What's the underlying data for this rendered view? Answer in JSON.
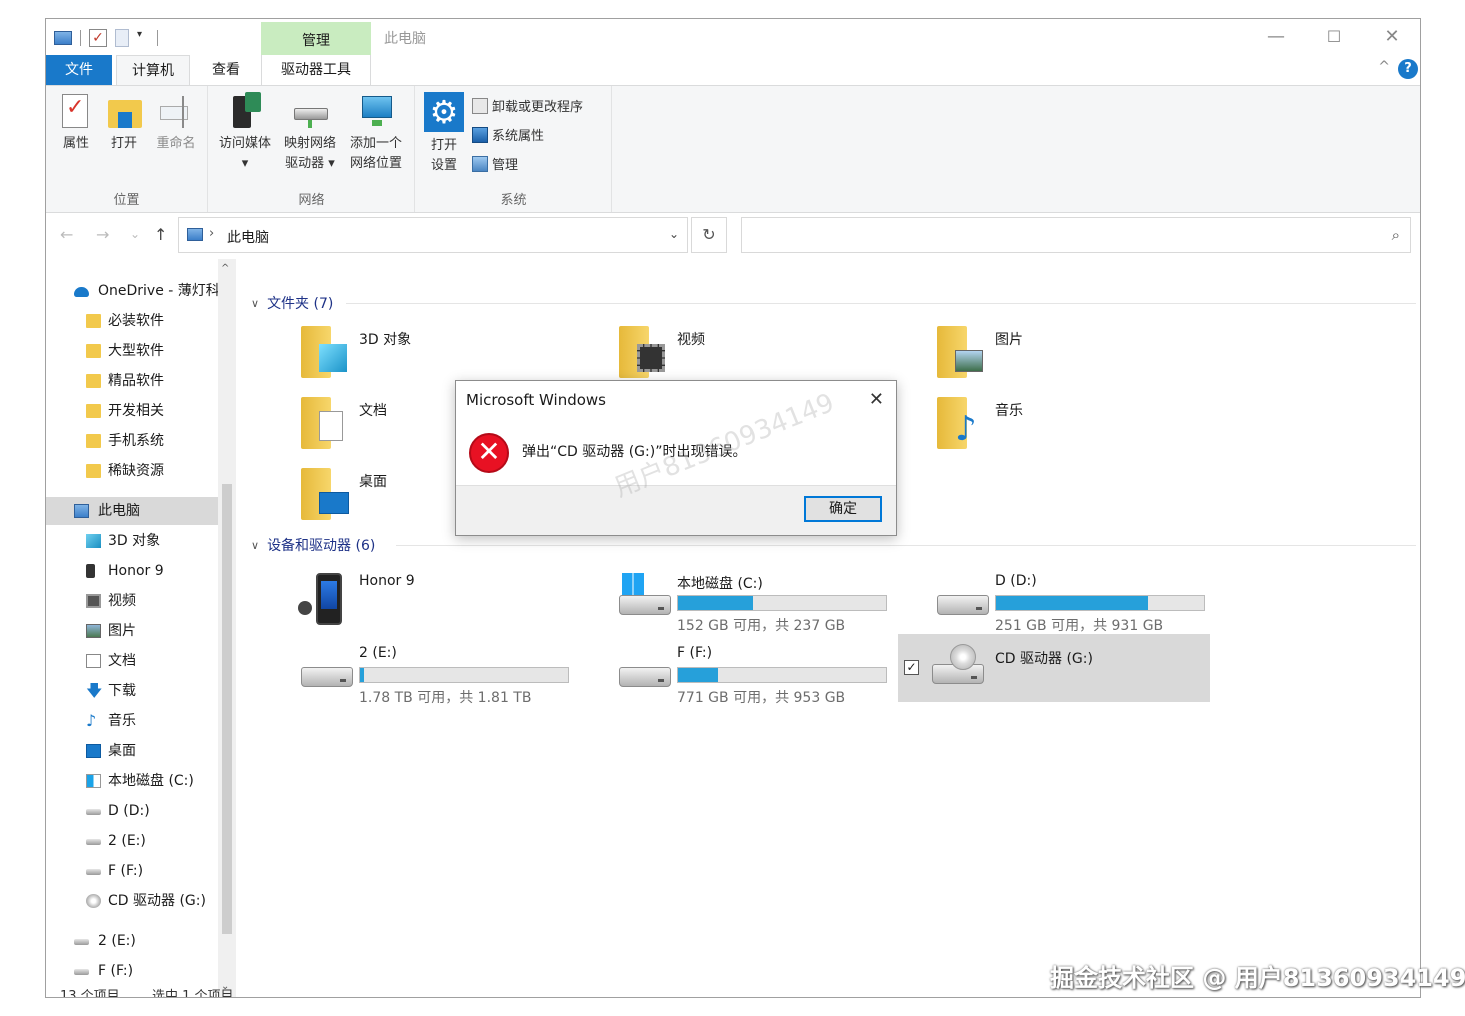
{
  "window": {
    "title": "此电脑",
    "min": "—",
    "max": "☐",
    "close": "✕"
  },
  "quick_access": {
    "dropdown": "▾"
  },
  "tabs": {
    "file": "文件",
    "computer": "计算机",
    "view": "查看",
    "manage": "管理",
    "drive_tools": "驱动器工具"
  },
  "help": {
    "collapse": "^",
    "icon": "?"
  },
  "ribbon": {
    "groups": {
      "location": "位置",
      "network": "网络",
      "system": "系统"
    },
    "properties": "属性",
    "open": "打开",
    "rename": "重命名",
    "access_media": "访问媒体",
    "access_media_arrow": "▾",
    "map_drive_1": "映射网络",
    "map_drive_2": "驱动器 ▾",
    "add_location_1": "添加一个",
    "add_location_2": "网络位置",
    "open_settings_1": "打开",
    "open_settings_2": "设置",
    "uninstall": "卸载或更改程序",
    "system_props": "系统属性",
    "manage": "管理"
  },
  "address": {
    "back": "←",
    "forward": "→",
    "recent": "⌄",
    "up": "↑",
    "chevron": "›",
    "path": "此电脑",
    "dropdown": "⌄",
    "refresh": "↻",
    "search_placeholder": "",
    "search_icon": "⌕"
  },
  "nav": {
    "scroll_up": "^",
    "scroll_down": "⌄",
    "items": [
      {
        "label": "OneDrive - 薄灯科",
        "icon": "cloud"
      },
      {
        "label": "必装软件",
        "icon": "folder"
      },
      {
        "label": "大型软件",
        "icon": "folder"
      },
      {
        "label": "精品软件",
        "icon": "folder"
      },
      {
        "label": "开发相关",
        "icon": "folder"
      },
      {
        "label": "手机系统",
        "icon": "folder"
      },
      {
        "label": "稀缺资源",
        "icon": "folder"
      },
      {
        "label": "此电脑",
        "icon": "pc"
      },
      {
        "label": "3D 对象",
        "icon": "3d"
      },
      {
        "label": "Honor 9",
        "icon": "phone"
      },
      {
        "label": "视频",
        "icon": "video"
      },
      {
        "label": "图片",
        "icon": "picture"
      },
      {
        "label": "文档",
        "icon": "document"
      },
      {
        "label": "下载",
        "icon": "download"
      },
      {
        "label": "音乐",
        "icon": "music"
      },
      {
        "label": "桌面",
        "icon": "desktop"
      },
      {
        "label": "本地磁盘 (C:)",
        "icon": "windows-drive"
      },
      {
        "label": "D (D:)",
        "icon": "drive"
      },
      {
        "label": "2 (E:)",
        "icon": "drive"
      },
      {
        "label": "F (F:)",
        "icon": "drive"
      },
      {
        "label": "CD 驱动器 (G:)",
        "icon": "cd"
      },
      {
        "label": "2 (E:)",
        "icon": "drive"
      },
      {
        "label": "F (F:)",
        "icon": "drive"
      }
    ]
  },
  "status": {
    "count": "13 个项目",
    "selected": "选中 1 个项目"
  },
  "content": {
    "folders_header": "文件夹 (7)",
    "devices_header": "设备和驱动器 (6)",
    "folders": [
      {
        "name": "3D 对象"
      },
      {
        "name": "视频"
      },
      {
        "name": "图片"
      },
      {
        "name": "文档"
      },
      {
        "name": "音乐"
      },
      {
        "name": "桌面"
      }
    ],
    "drives": [
      {
        "name": "Honor 9"
      },
      {
        "name": "本地磁盘 (C:)",
        "free": "152 GB 可用，共 237 GB",
        "used_fraction": 0.36
      },
      {
        "name": "D (D:)",
        "free": "251 GB 可用，共 931 GB",
        "used_fraction": 0.73
      },
      {
        "name": "2 (E:)",
        "free": "1.78 TB 可用，共 1.81 TB",
        "used_fraction": 0.02
      },
      {
        "name": "F (F:)",
        "free": "771 GB 可用，共 953 GB",
        "used_fraction": 0.19
      },
      {
        "name": "CD 驱动器 (G:)",
        "checked": "✓"
      }
    ]
  },
  "dialog": {
    "title": "Microsoft Windows",
    "close": "✕",
    "error_icon": "✕",
    "message": "弹出“CD 驱动器 (G:)”时出现错误。",
    "ok": "确定"
  },
  "watermark": "用户81360934149",
  "footer_watermark": "掘金技术社区 @ 用户81360934149",
  "colors": {
    "accent": "#1979ca",
    "manage_tab": "#c9ecc0",
    "drive_bar": "#26a0da",
    "error": "#e81123",
    "ok_border": "#0078d7"
  }
}
